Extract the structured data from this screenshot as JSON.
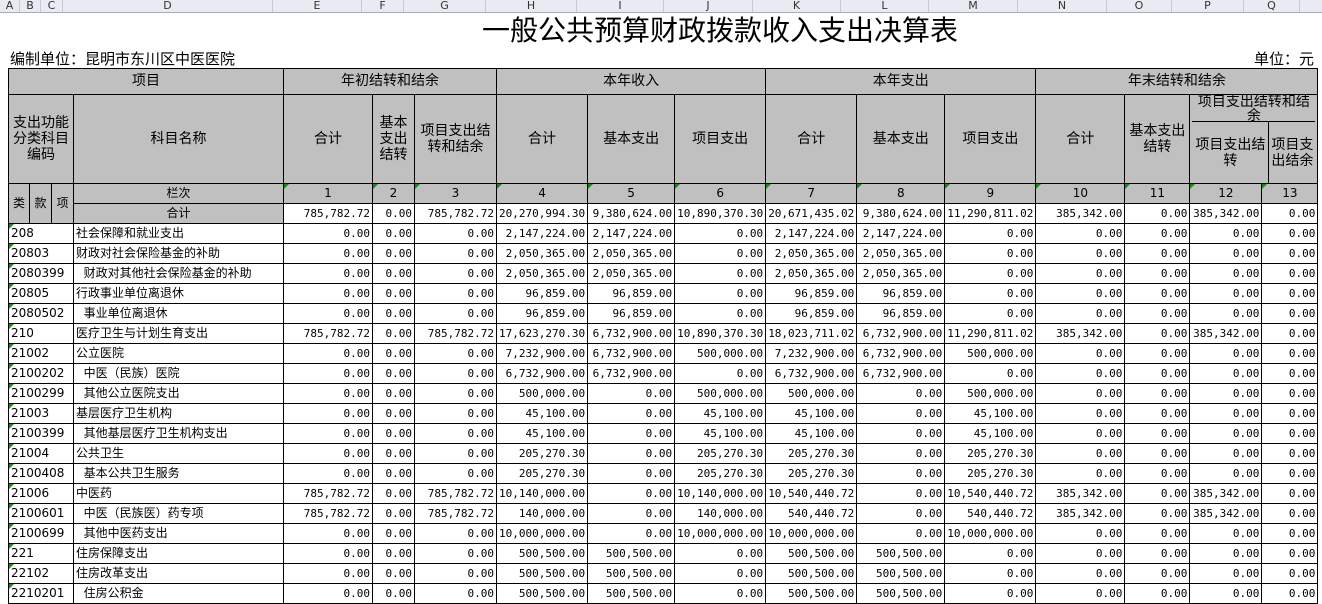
{
  "sheet": {
    "col_letters": [
      "A",
      "B",
      "C",
      "D",
      "E",
      "F",
      "G",
      "H",
      "I",
      "J",
      "K",
      "L",
      "M",
      "N",
      "O",
      "P",
      "Q"
    ],
    "title": "一般公共预算财政拨款收入支出决算表",
    "org": "编制单位：昆明市东川区中医医院",
    "unit": "单位：元"
  },
  "header": {
    "project": "项目",
    "begin_balance": "年初结转和结余",
    "income": "本年收入",
    "expense": "本年支出",
    "end_balance": "年末结转和结余",
    "func_code": "支出功能分类科目编码",
    "subject_name": "科目名称",
    "total": "合计",
    "basic_carry": "基本支出结转",
    "proj_carry": "项目支出结转和结余",
    "basic": "基本支出",
    "project_exp": "项目支出",
    "basic_carry2": "基本支出结转",
    "proj_carry_group": "项目支出结转和结余",
    "proj_carry_sub": "项目支出结转",
    "proj_surplus_sub": "项目支出结余",
    "lei": "类",
    "kuan": "款",
    "xiang": "项",
    "lanci": "栏次",
    "col_nums": [
      "1",
      "2",
      "3",
      "4",
      "5",
      "6",
      "7",
      "8",
      "9",
      "10",
      "11",
      "12",
      "13"
    ],
    "sum_label": "合计",
    "sum_values": [
      "785,782.72",
      "0.00",
      "785,782.72",
      "20,270,994.30",
      "9,380,624.00",
      "10,890,370.30",
      "20,671,435.02",
      "9,380,624.00",
      "11,290,811.02",
      "385,342.00",
      "0.00",
      "385,342.00",
      "0.00"
    ]
  },
  "rows": [
    {
      "code": "208",
      "name": "社会保障和就业支出",
      "v": [
        "0.00",
        "0.00",
        "0.00",
        "2,147,224.00",
        "2,147,224.00",
        "0.00",
        "2,147,224.00",
        "2,147,224.00",
        "0.00",
        "0.00",
        "0.00",
        "0.00",
        "0.00"
      ]
    },
    {
      "code": "20803",
      "name": "财政对社会保险基金的补助",
      "v": [
        "0.00",
        "0.00",
        "0.00",
        "2,050,365.00",
        "2,050,365.00",
        "0.00",
        "2,050,365.00",
        "2,050,365.00",
        "0.00",
        "0.00",
        "0.00",
        "0.00",
        "0.00"
      ]
    },
    {
      "code": "2080399",
      "name": "  财政对其他社会保险基金的补助",
      "v": [
        "0.00",
        "0.00",
        "0.00",
        "2,050,365.00",
        "2,050,365.00",
        "0.00",
        "2,050,365.00",
        "2,050,365.00",
        "0.00",
        "0.00",
        "0.00",
        "0.00",
        "0.00"
      ]
    },
    {
      "code": "20805",
      "name": "行政事业单位离退休",
      "v": [
        "0.00",
        "0.00",
        "0.00",
        "96,859.00",
        "96,859.00",
        "0.00",
        "96,859.00",
        "96,859.00",
        "0.00",
        "0.00",
        "0.00",
        "0.00",
        "0.00"
      ]
    },
    {
      "code": "2080502",
      "name": "  事业单位离退休",
      "v": [
        "0.00",
        "0.00",
        "0.00",
        "96,859.00",
        "96,859.00",
        "0.00",
        "96,859.00",
        "96,859.00",
        "0.00",
        "0.00",
        "0.00",
        "0.00",
        "0.00"
      ]
    },
    {
      "code": "210",
      "name": "医疗卫生与计划生育支出",
      "v": [
        "785,782.72",
        "0.00",
        "785,782.72",
        "17,623,270.30",
        "6,732,900.00",
        "10,890,370.30",
        "18,023,711.02",
        "6,732,900.00",
        "11,290,811.02",
        "385,342.00",
        "0.00",
        "385,342.00",
        "0.00"
      ]
    },
    {
      "code": "21002",
      "name": "公立医院",
      "v": [
        "0.00",
        "0.00",
        "0.00",
        "7,232,900.00",
        "6,732,900.00",
        "500,000.00",
        "7,232,900.00",
        "6,732,900.00",
        "500,000.00",
        "0.00",
        "0.00",
        "0.00",
        "0.00"
      ]
    },
    {
      "code": "2100202",
      "name": "  中医（民族）医院",
      "v": [
        "0.00",
        "0.00",
        "0.00",
        "6,732,900.00",
        "6,732,900.00",
        "0.00",
        "6,732,900.00",
        "6,732,900.00",
        "0.00",
        "0.00",
        "0.00",
        "0.00",
        "0.00"
      ]
    },
    {
      "code": "2100299",
      "name": "  其他公立医院支出",
      "v": [
        "0.00",
        "0.00",
        "0.00",
        "500,000.00",
        "0.00",
        "500,000.00",
        "500,000.00",
        "0.00",
        "500,000.00",
        "0.00",
        "0.00",
        "0.00",
        "0.00"
      ]
    },
    {
      "code": "21003",
      "name": "基层医疗卫生机构",
      "v": [
        "0.00",
        "0.00",
        "0.00",
        "45,100.00",
        "0.00",
        "45,100.00",
        "45,100.00",
        "0.00",
        "45,100.00",
        "0.00",
        "0.00",
        "0.00",
        "0.00"
      ]
    },
    {
      "code": "2100399",
      "name": "  其他基层医疗卫生机构支出",
      "v": [
        "0.00",
        "0.00",
        "0.00",
        "45,100.00",
        "0.00",
        "45,100.00",
        "45,100.00",
        "0.00",
        "45,100.00",
        "0.00",
        "0.00",
        "0.00",
        "0.00"
      ]
    },
    {
      "code": "21004",
      "name": "公共卫生",
      "v": [
        "0.00",
        "0.00",
        "0.00",
        "205,270.30",
        "0.00",
        "205,270.30",
        "205,270.30",
        "0.00",
        "205,270.30",
        "0.00",
        "0.00",
        "0.00",
        "0.00"
      ]
    },
    {
      "code": "2100408",
      "name": "  基本公共卫生服务",
      "v": [
        "0.00",
        "0.00",
        "0.00",
        "205,270.30",
        "0.00",
        "205,270.30",
        "205,270.30",
        "0.00",
        "205,270.30",
        "0.00",
        "0.00",
        "0.00",
        "0.00"
      ]
    },
    {
      "code": "21006",
      "name": "中医药",
      "v": [
        "785,782.72",
        "0.00",
        "785,782.72",
        "10,140,000.00",
        "0.00",
        "10,140,000.00",
        "10,540,440.72",
        "0.00",
        "10,540,440.72",
        "385,342.00",
        "0.00",
        "385,342.00",
        "0.00"
      ]
    },
    {
      "code": "2100601",
      "name": "  中医（民族医）药专项",
      "v": [
        "785,782.72",
        "0.00",
        "785,782.72",
        "140,000.00",
        "0.00",
        "140,000.00",
        "540,440.72",
        "0.00",
        "540,440.72",
        "385,342.00",
        "0.00",
        "385,342.00",
        "0.00"
      ]
    },
    {
      "code": "2100699",
      "name": "  其他中医药支出",
      "v": [
        "0.00",
        "0.00",
        "0.00",
        "10,000,000.00",
        "0.00",
        "10,000,000.00",
        "10,000,000.00",
        "0.00",
        "10,000,000.00",
        "0.00",
        "0.00",
        "0.00",
        "0.00"
      ]
    },
    {
      "code": "221",
      "name": "住房保障支出",
      "v": [
        "0.00",
        "0.00",
        "0.00",
        "500,500.00",
        "500,500.00",
        "0.00",
        "500,500.00",
        "500,500.00",
        "0.00",
        "0.00",
        "0.00",
        "0.00",
        "0.00"
      ]
    },
    {
      "code": "22102",
      "name": "住房改革支出",
      "v": [
        "0.00",
        "0.00",
        "0.00",
        "500,500.00",
        "500,500.00",
        "0.00",
        "500,500.00",
        "500,500.00",
        "0.00",
        "0.00",
        "0.00",
        "0.00",
        "0.00"
      ]
    },
    {
      "code": "2210201",
      "name": "  住房公积金",
      "v": [
        "0.00",
        "0.00",
        "0.00",
        "500,500.00",
        "500,500.00",
        "0.00",
        "500,500.00",
        "500,500.00",
        "0.00",
        "0.00",
        "0.00",
        "0.00",
        "0.00"
      ]
    }
  ]
}
